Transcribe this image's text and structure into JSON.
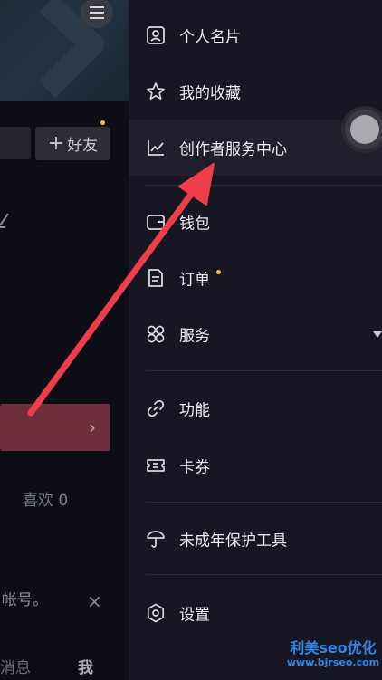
{
  "left_page": {
    "add_friend_label": "好友",
    "add_friend_plus": "+",
    "likes_label": "喜欢 0",
    "account_text": "帐号。",
    "close_glyph": "×",
    "chevron_glyph": "›",
    "tab_message": "消息",
    "tab_me": "我"
  },
  "drawer": {
    "items": [
      {
        "label": "个人名片",
        "icon": "profile-card-icon"
      },
      {
        "label": "我的收藏",
        "icon": "star-icon"
      },
      {
        "label": "创作者服务中心",
        "icon": "chart-line-icon"
      },
      {
        "label": "钱包",
        "icon": "wallet-icon"
      },
      {
        "label": "订单",
        "icon": "order-document-icon"
      },
      {
        "label": "服务",
        "icon": "four-leaf-grid-icon"
      },
      {
        "label": "功能",
        "icon": "link-icon"
      },
      {
        "label": "卡券",
        "icon": "ticket-icon"
      },
      {
        "label": "未成年保护工具",
        "icon": "umbrella-icon"
      },
      {
        "label": "设置",
        "icon": "settings-gear-icon"
      }
    ]
  },
  "watermark": {
    "main": "利美seo优化",
    "url": "www.bjrseo.com"
  },
  "colors": {
    "drawer_bg": "#161722",
    "highlight_row": "#1f202b",
    "annotation_arrow": "#ee3e4a",
    "badge_dot": "#f2c230",
    "watermark": "#2f86e8"
  }
}
